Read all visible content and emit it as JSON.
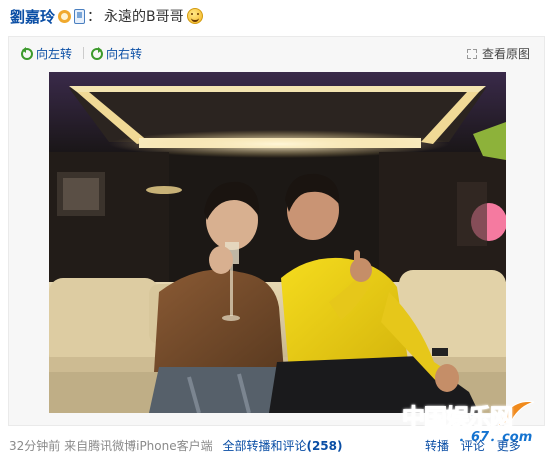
{
  "post": {
    "author": "劉嘉玲",
    "colon": "：",
    "text": "永遠的B哥哥"
  },
  "toolbar": {
    "rotate_left": "向左转",
    "rotate_right": "向右转",
    "view_original": "查看原图"
  },
  "footer": {
    "time": "32分钟前",
    "source": "来自腾讯微博iPhone客户端",
    "all_label": "全部转播和评论",
    "all_count": "(258)",
    "actions": [
      "转播",
      "评论",
      "更多"
    ]
  },
  "watermark": {
    "text": "中国娱乐网",
    "url": "．67．com"
  },
  "icons": {
    "verified": "verified-badge-icon",
    "mobile": "mobile-post-icon",
    "emoticon": "smile-icon",
    "rotate_left": "rotate-left-icon",
    "rotate_right": "rotate-right-icon",
    "expand": "expand-icon"
  },
  "colors": {
    "link": "#0a4ea5",
    "meta": "#8a8a8a",
    "rotate": "#3c9a2c",
    "watermark": "#1473d0"
  }
}
